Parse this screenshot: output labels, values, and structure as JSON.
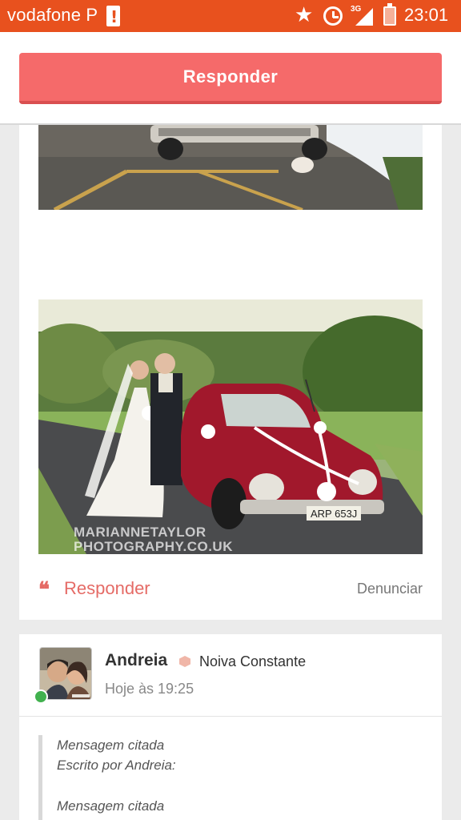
{
  "status_bar": {
    "carrier": "vodafone P",
    "network": "3G",
    "time": "23:01"
  },
  "header": {
    "reply_button": "Responder"
  },
  "post": {
    "images": [
      {
        "description_icon": "wedding-car-photo-top"
      },
      {
        "description_icon": "wedding-couple-red-beetle-photo",
        "watermark_line1": "MARIANNETAYLOR",
        "watermark_line2": "PHOTOGRAPHY.CO.UK"
      }
    ],
    "actions": {
      "quote_icon": "❝",
      "reply_label": "Responder",
      "report_label": "Denunciar"
    }
  },
  "comment": {
    "author": "Andreia",
    "rank": "Noiva Constante",
    "time": "Hoje às 19:25",
    "online": true,
    "quote": {
      "line1": "Mensagem citada",
      "line2": "Escrito por Andreia:",
      "line3": "Mensagem citada"
    }
  },
  "colors": {
    "status_bar": "#e8511e",
    "primary_button": "#f56a6a",
    "accent_text": "#e56b66",
    "online": "#41b14e"
  }
}
